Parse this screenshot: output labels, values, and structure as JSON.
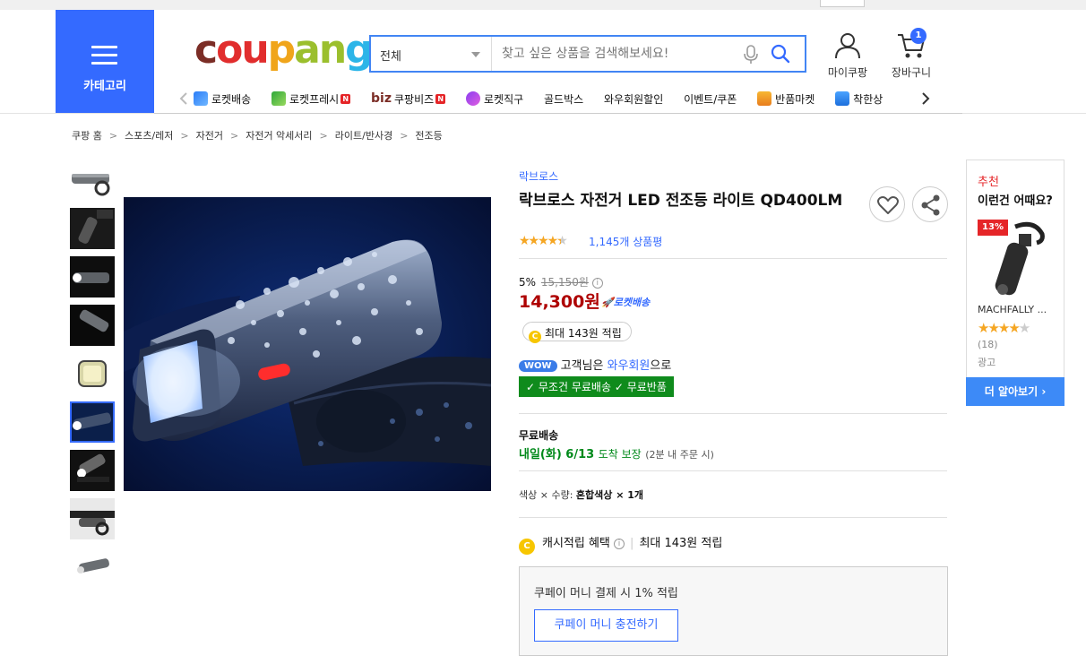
{
  "topbar": {
    "left_text": "",
    "mid_text": "",
    "right_text": ""
  },
  "header": {
    "category_label": "카테고리",
    "logo_parts": [
      "c",
      "ou",
      "p",
      "an",
      "g"
    ],
    "search_category": "전체",
    "search_placeholder": "찾고 싶은 상품을 검색해보세요!",
    "my_label": "마이쿠팡",
    "cart_label": "장바구니",
    "cart_count": "1"
  },
  "nav": {
    "items": [
      {
        "label": "로켓배송",
        "icon": "rocket-icon"
      },
      {
        "label": "로켓프레시",
        "icon": "rocket-fresh-icon",
        "new": "N"
      },
      {
        "prefix": "biz",
        "label": "쿠팡비즈",
        "new": "N"
      },
      {
        "label": "로켓직구",
        "icon": "global-rocket-icon"
      },
      {
        "label": "골드박스"
      },
      {
        "label": "와우회원할인"
      },
      {
        "label": "이벤트/쿠폰"
      },
      {
        "label": "반품마켓",
        "icon": "market-icon"
      },
      {
        "label": "착한상",
        "icon": "good-store-icon"
      }
    ]
  },
  "breadcrumb": [
    "쿠팡 홈",
    "스포츠/레저",
    "자전거",
    "자전거 악세서리",
    "라이트/반사경",
    "전조등"
  ],
  "product": {
    "brand": "락브로스",
    "title": "락브로스 자전거 LED 전조등 라이트 QD400LM",
    "rating": 4.5,
    "review_count": "1,145개 상품평",
    "discount_rate": "5%",
    "original_price": "15,150원",
    "price": "14,300원",
    "rocket_label": "로켓배송",
    "max_points": "최대 143원 적립",
    "wow_badge": "WOW",
    "wow_text_1": "고객님은",
    "wow_link": "와우회원",
    "wow_text_2": "으로",
    "free_ship": "무조건 무료배송",
    "free_return": "무료반품",
    "shipping_title": "무료배송",
    "delivery_date": "내일(화) 6/13",
    "delivery_guarantee": "도착 보장",
    "delivery_condition": "(2분 내 주문 시)",
    "option_label": "색상 × 수량:",
    "option_value": "혼합색상 × 1개",
    "cash_label": "캐시적립 혜택",
    "cash_value": "최대 143원 적립",
    "money_text": "쿠페이 머니 결제 시 1% 적립",
    "money_button": "쿠페이 머니 충전하기"
  },
  "recommend": {
    "label": "추천",
    "title": "이런건 어때요?",
    "discount": "13%",
    "name": "MACHFALLY ...",
    "rating": 4,
    "count": "(18)",
    "ad": "광고",
    "more": "더 알아보기"
  },
  "colors": {
    "accent": "#346aff",
    "price": "#ae0000",
    "free_ship_bg": "#0f8b1c",
    "delivery": "#00891a",
    "star": "#f5a623"
  }
}
